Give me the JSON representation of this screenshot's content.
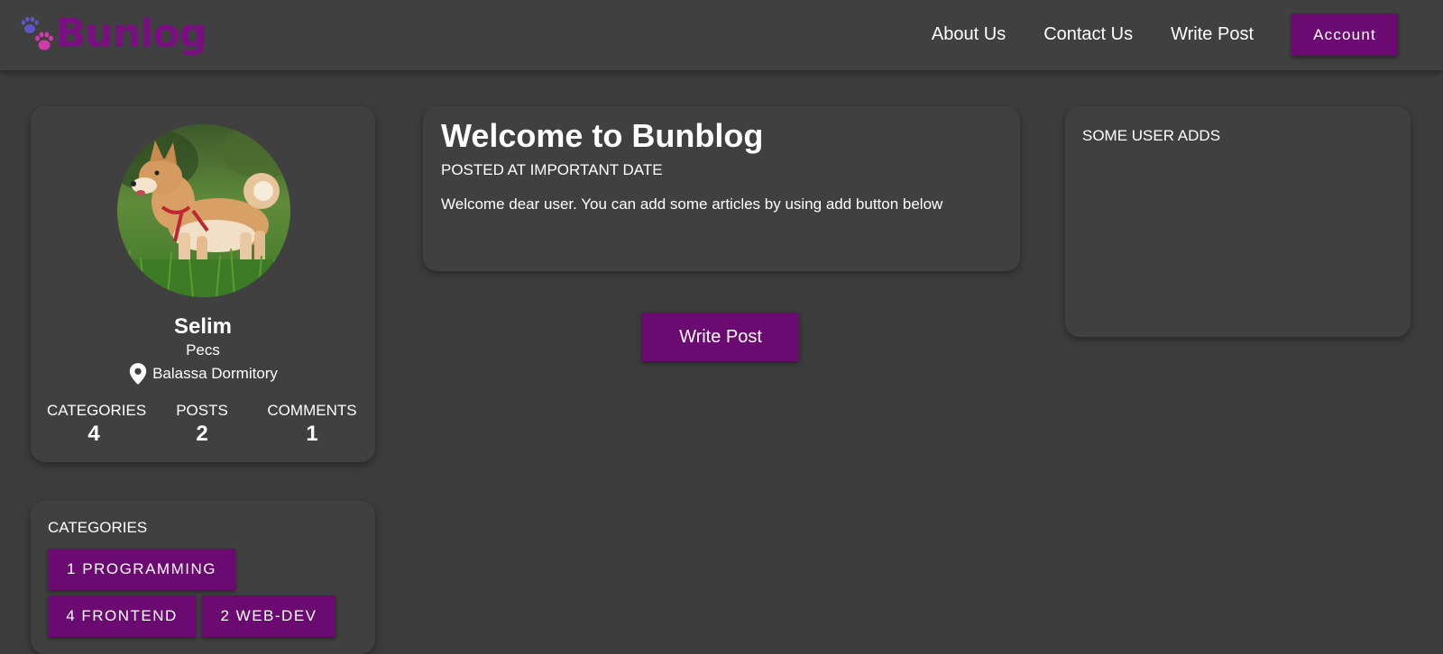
{
  "header": {
    "logo_text": "Bunlog",
    "nav": {
      "about": "About Us",
      "contact": "Contact Us",
      "write_post": "Write Post"
    },
    "account_label": "Account"
  },
  "profile": {
    "name": "Selim",
    "city": "Pecs",
    "location": "Balassa Dormitory",
    "stats": [
      {
        "label": "CATEGORIES",
        "value": "4"
      },
      {
        "label": "POSTS",
        "value": "2"
      },
      {
        "label": "COMMENTS",
        "value": "1"
      }
    ]
  },
  "categories": {
    "title": "CATEGORIES",
    "items": [
      "1 PROGRAMMING",
      "4 FRONTEND",
      "2 WEB-DEV"
    ]
  },
  "welcome": {
    "title": "Welcome to Bunblog",
    "date": "POSTED AT IMPORTANT DATE",
    "body": "Welcome dear user. You can add some articles by using add button below"
  },
  "main": {
    "write_post_label": "Write Post"
  },
  "adds": {
    "title": "SOME USER ADDS"
  },
  "icons": {
    "logo": "paw-icon",
    "location": "location-pin-icon"
  },
  "colors": {
    "background": "#3c3c3c",
    "card": "#404040",
    "accent": "#6b0a70",
    "logo": "#7a0f82"
  }
}
